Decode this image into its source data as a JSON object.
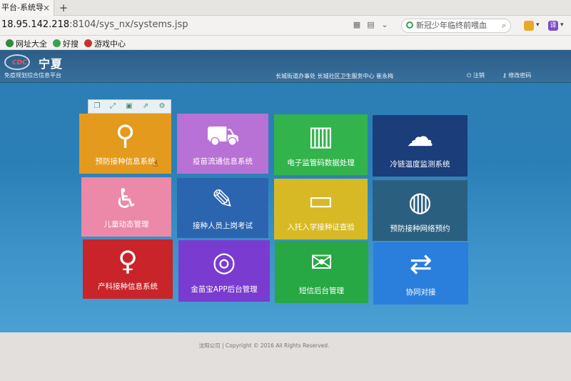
{
  "browser": {
    "tab_title": "平台-系统导",
    "tab_close": "×",
    "new_tab": "+",
    "url_host": "18.95.142.218",
    "url_path": ":8104/sys_nx/systems.jsp",
    "search_text": "新冠少年临终前喂血",
    "search_icon": "search-icon",
    "bookmarks": [
      {
        "label": "网址大全",
        "color": "#2c8c3b"
      },
      {
        "label": "好搜",
        "color": "#3aa24e"
      },
      {
        "label": "游戏中心",
        "color": "#c9322c"
      }
    ]
  },
  "header": {
    "logo_text": "CDC",
    "title": "宁夏",
    "subtitle": "免疫规划综合信息平台",
    "user_info": "长城街道办事处  长城社区卫生服务中心  崔永梅",
    "logout_label": "注销",
    "change_password_label": "修改密码"
  },
  "toolbar": {
    "icons": [
      "copy-icon",
      "fullscreen-icon",
      "save-icon",
      "export-icon",
      "settings-icon"
    ]
  },
  "tiles": [
    {
      "label": "预防接种信息系统",
      "color": "#e49a1d",
      "icon": "vaccination-icon",
      "glyph": "⚲"
    },
    {
      "label": "疫苗流通信息系统",
      "color": "#b871d4",
      "icon": "delivery-truck-icon",
      "glyph": "⛟"
    },
    {
      "label": "电子监管码数据处理",
      "color": "#33b34c",
      "icon": "barcode-icon",
      "glyph": "▥"
    },
    {
      "label": "冷链温度监测系统",
      "color": "#1b3d7a",
      "icon": "cold-cloud-icon",
      "glyph": "☁"
    },
    {
      "label": "儿童动态管理",
      "color": "#ec88a8",
      "icon": "stroller-icon",
      "glyph": "♿"
    },
    {
      "label": "接种人员上岗考试",
      "color": "#2b65b0",
      "icon": "exam-pencil-icon",
      "glyph": "✎"
    },
    {
      "label": "入托入学接种证查验",
      "color": "#d7b925",
      "icon": "certificate-card-icon",
      "glyph": "▭"
    },
    {
      "label": "预防接种网络预约",
      "color": "#2b5f80",
      "icon": "globe-monitor-icon",
      "glyph": "◍"
    },
    {
      "label": "产科接种信息系统",
      "color": "#c8242a",
      "icon": "pregnancy-book-icon",
      "glyph": "♀"
    },
    {
      "label": "金苗宝APP后台管理",
      "color": "#7a3cd0",
      "icon": "app-box-icon",
      "glyph": "◎"
    },
    {
      "label": "短信后台管理",
      "color": "#27a845",
      "icon": "sms-bubble-icon",
      "glyph": "✉"
    },
    {
      "label": "协同对接",
      "color": "#2a7fdc",
      "icon": "exchange-arrows-icon",
      "glyph": "⇄"
    }
  ],
  "footer": {
    "text": "沈阳公司 | Copyright © 2016 All Rights Reserved."
  }
}
